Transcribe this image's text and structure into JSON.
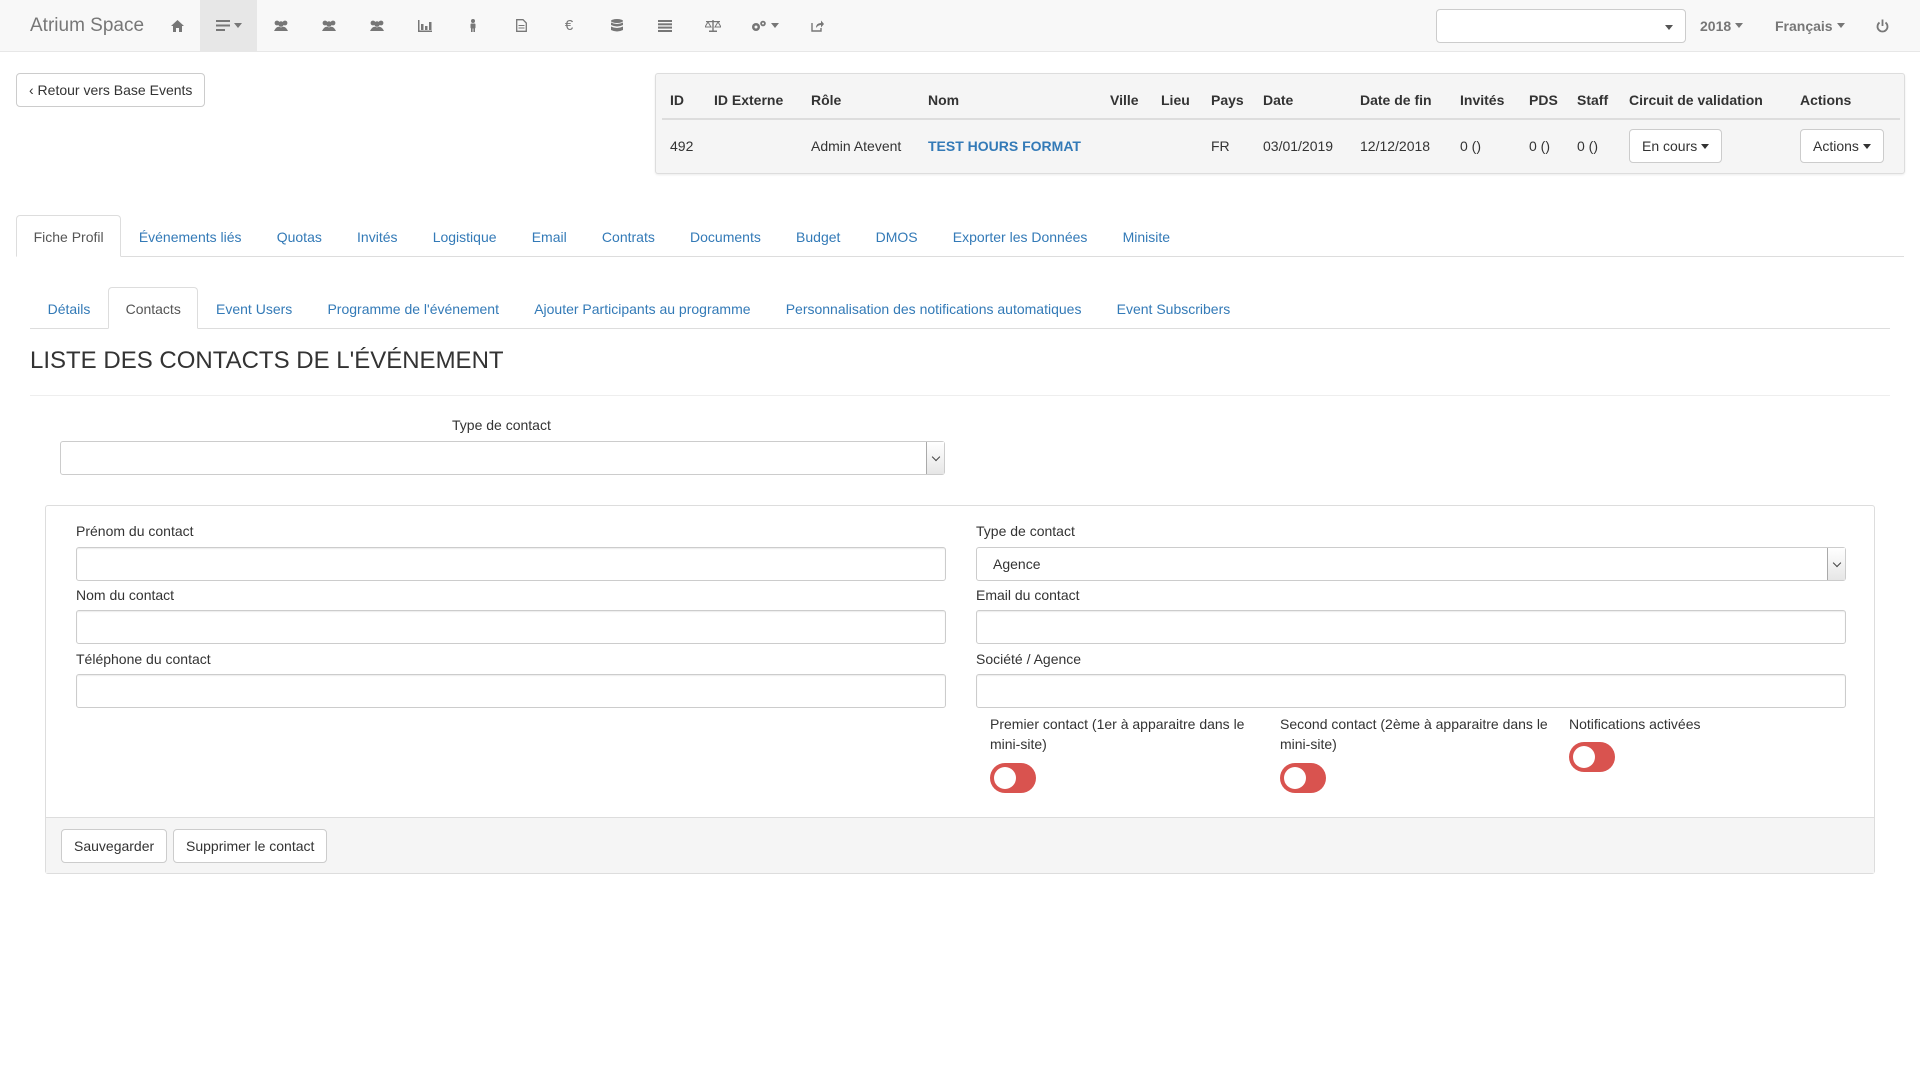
{
  "navbar": {
    "brand": "Atrium Space",
    "icons": [
      "home-icon",
      "list-dropdown-icon",
      "group-icon",
      "group-icon-2",
      "group-icon-3",
      "chart-icon",
      "person-icon",
      "document-icon",
      "euro-icon",
      "database-icon",
      "list-icon",
      "balance-icon",
      "cogs-dropdown-icon",
      "share-icon"
    ],
    "euro_glyph": "€",
    "year": "2018",
    "language": "Français",
    "select_value": ""
  },
  "back_button": "‹ Retour vers Base Events",
  "event_table": {
    "headers": [
      "ID",
      "ID Externe",
      "Rôle",
      "Nom",
      "Ville",
      "Lieu",
      "Pays",
      "Date",
      "Date de fin",
      "Invités",
      "PDS",
      "Staff",
      "Circuit de validation",
      "Actions"
    ],
    "row": {
      "id": "492",
      "id_externe": "",
      "role": "Admin Atevent",
      "nom": "TEST HOURS FORMAT",
      "ville": "",
      "lieu": "",
      "pays": "FR",
      "date": "03/01/2019",
      "date_fin": "12/12/2018",
      "invites": "0 ()",
      "pds": "0 ()",
      "staff": "0 ()",
      "circuit": "En cours",
      "actions": "Actions"
    }
  },
  "main_tabs": [
    "Fiche Profil",
    "Événements liés",
    "Quotas",
    "Invités",
    "Logistique",
    "Email",
    "Contrats",
    "Documents",
    "Budget",
    "DMOS",
    "Exporter les Données",
    "Minisite"
  ],
  "sub_tabs": [
    "Détails",
    "Contacts",
    "Event Users",
    "Programme de l'événement",
    "Ajouter Participants au programme",
    "Personnalisation des notifications automatiques",
    "Event Subscribers"
  ],
  "heading": "LISTE DES CONTACTS DE L'ÉVÉNEMENT",
  "filter": {
    "label": "Type de contact",
    "value": ""
  },
  "form": {
    "first_name_label": "Prénom du contact",
    "first_name_value": "",
    "contact_type_label": "Type de contact",
    "contact_type_value": "Agence",
    "last_name_label": "Nom du contact",
    "last_name_value": "",
    "email_label": "Email du contact",
    "email_value": "",
    "phone_label": "Téléphone du contact",
    "phone_value": "",
    "company_label": "Société / Agence",
    "company_value": "",
    "premier_label": "Premier contact (1er à apparaitre dans le mini-site)",
    "second_label": "Second contact (2ème à apparaitre dans le mini-site)",
    "notif_label": "Notifications activées",
    "premier_on": false,
    "second_on": false,
    "notif_on": false,
    "toggle_off_color": "#d9534f",
    "save_button": "Sauvegarder",
    "delete_button": "Supprimer le contact"
  }
}
